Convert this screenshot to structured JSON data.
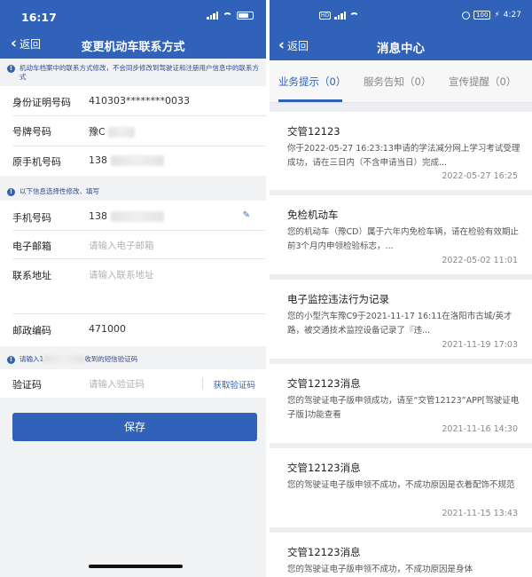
{
  "left": {
    "status": {
      "time": "16:17"
    },
    "nav": {
      "back_label": "返回",
      "title": "变更机动车联系方式"
    },
    "notice1": "机动车档案中的联系方式修改，不会同步修改到驾驶证和注册用户信息中的联系方式",
    "fields1": [
      {
        "label": "身份证明号码",
        "value": "410303********0033"
      },
      {
        "label": "号牌号码",
        "value": "豫C"
      },
      {
        "label": "原手机号码",
        "value": "138"
      }
    ],
    "notice2": "以下信息选择性修改、填写",
    "fields2": {
      "phone_label": "手机号码",
      "phone_value": "138",
      "email_label": "电子邮箱",
      "email_placeholder": "请输入电子邮箱",
      "address_label": "联系地址",
      "address_placeholder": "请输入联系地址",
      "postcode_label": "邮政编码",
      "postcode_value": "471000"
    },
    "notice3_prefix": "请输入1",
    "notice3_suffix": "收到的短信验证码",
    "code": {
      "label": "验证码",
      "placeholder": "请输入验证码",
      "get_code": "获取验证码"
    },
    "save_label": "保存"
  },
  "right": {
    "status": {
      "time": "4:27",
      "battery": "100"
    },
    "nav": {
      "back_label": "返回",
      "title": "消息中心"
    },
    "tabs": [
      {
        "label": "业务提示（0）",
        "active": true
      },
      {
        "label": "服务告知（0）",
        "active": false
      },
      {
        "label": "宣传提醒（0）",
        "active": false
      }
    ],
    "messages": [
      {
        "title": "交管12123",
        "body": "你于2022-05-27 16:23:13申请的学法减分网上学习考试受理成功，请在三日内（不含申请当日）完成...",
        "date": "2022-05-27 16:25"
      },
      {
        "title": "免检机动车",
        "body": "您的机动车（豫CD）属于六年内免检车辆，请在检验有效期止前3个月内申领检验标志，...",
        "date": "2022-05-02 11:01"
      },
      {
        "title": "电子监控违法行为记录",
        "body": "您的小型汽车豫C9于2021-11-17 16:11在洛阳市古城/英才路，被交通技术监控设备记录了『违...",
        "date": "2021-11-19 17:03"
      },
      {
        "title": "交管12123消息",
        "body": "您的驾驶证电子版申领成功，请至“交管12123”APP[驾驶证电子版]功能查看",
        "date": "2021-11-16 14:30"
      },
      {
        "title": "交管12123消息",
        "body": "您的驾驶证电子版申领不成功，不成功原因是衣着配饰不规范",
        "date": "2021-11-15 13:43"
      },
      {
        "title": "交管12123消息",
        "body": "您的驾驶证电子版申领不成功，不成功原因是身体",
        "date": ""
      }
    ]
  },
  "colors": {
    "primary": "#2f62b8",
    "background": "#f1f2f4"
  }
}
